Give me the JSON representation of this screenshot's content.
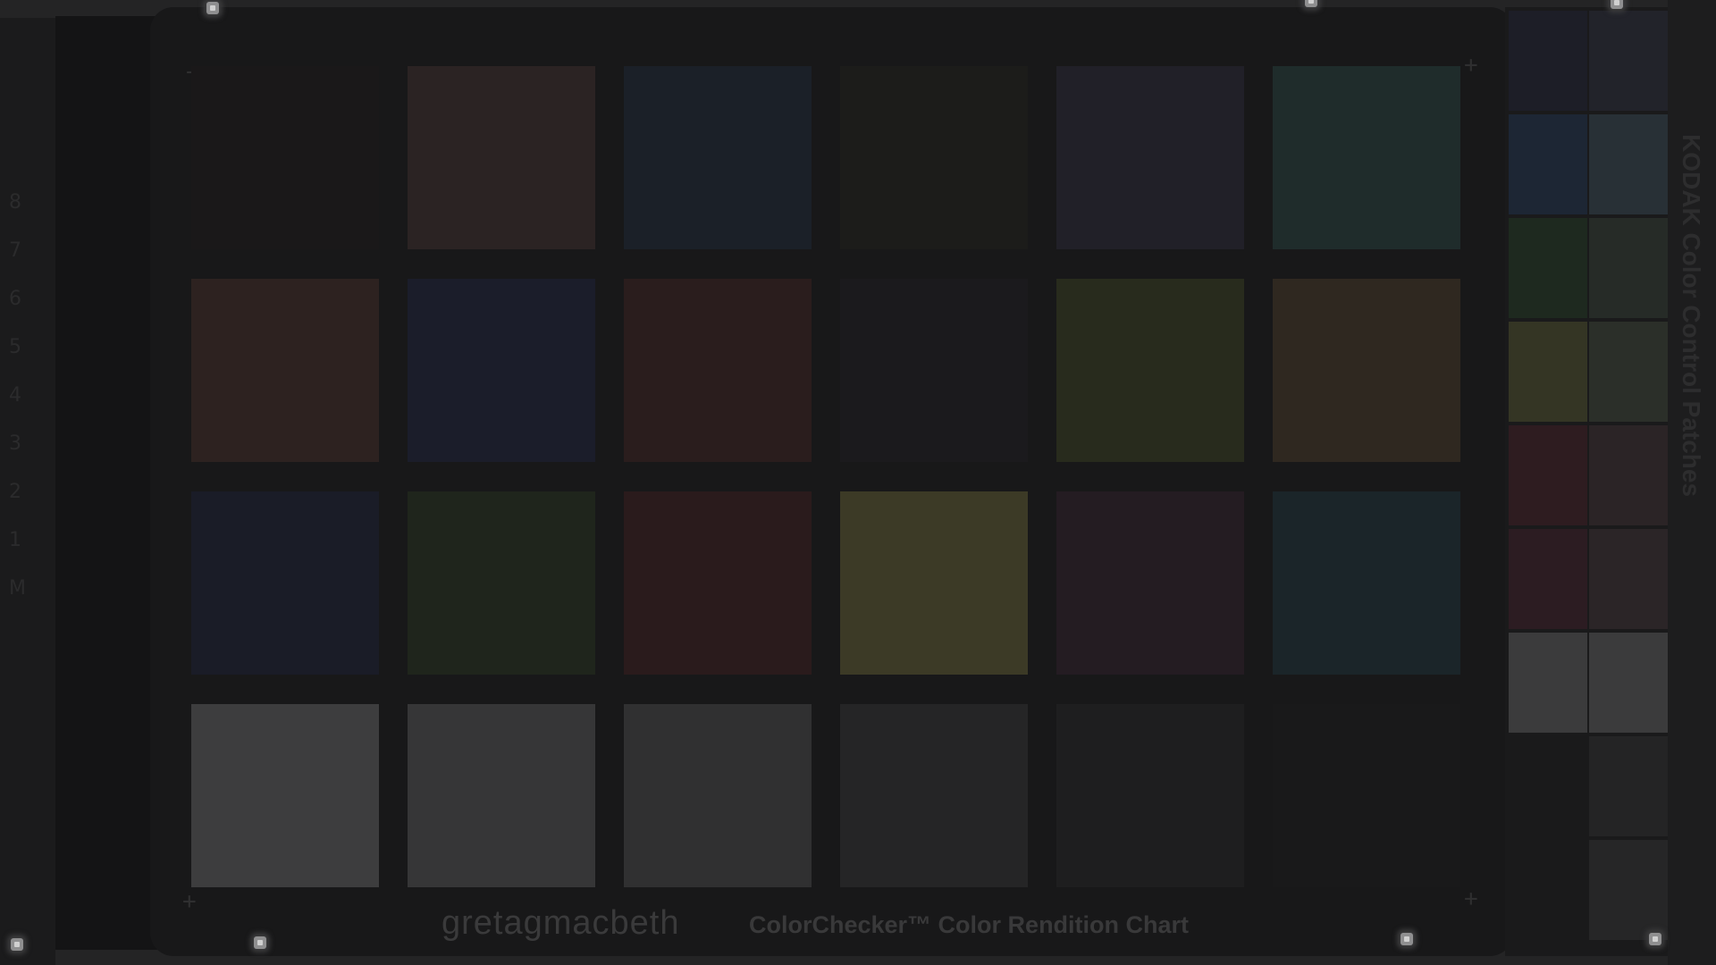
{
  "image": {
    "brand_text": "gretagmacbeth",
    "chart_title": "ColorChecker™ Color Rendition Chart",
    "side_label": "KODAK Color Control Patches",
    "left_marks": [
      "8",
      "7",
      "6",
      "5",
      "4",
      "3",
      "2",
      "1",
      "M"
    ]
  },
  "colors": {
    "background": "#242425",
    "main_card": "#181819",
    "macbeth_patches": [
      "#1a1819",
      "#2b2323",
      "#1b2028",
      "#1c1c1a",
      "#212028",
      "#1f2c2b",
      "#2d2220",
      "#1b1d2a",
      "#2a1d1d",
      "#1b1a1d",
      "#282b1d",
      "#2f2820",
      "#1a1c27",
      "#1f251c",
      "#2a1b1c",
      "#3c3a26",
      "#241c22",
      "#1b2529",
      "#3d3d3e",
      "#363637",
      "#303031",
      "#252526",
      "#1e1e1f",
      "#19191a"
    ],
    "kodak_patches": [
      "#1d1e27",
      "#22232a",
      "#1d2634",
      "#283036",
      "#1e291f",
      "#262b27",
      "#343524",
      "#2b2f29",
      "#2e1c20",
      "#2b2426",
      "#2c1c22",
      "#2b2527",
      "#3b3b3c",
      "#3b3b3c",
      "#1a1a1b",
      "#242425",
      "#1a1a1b",
      "#262627"
    ]
  }
}
